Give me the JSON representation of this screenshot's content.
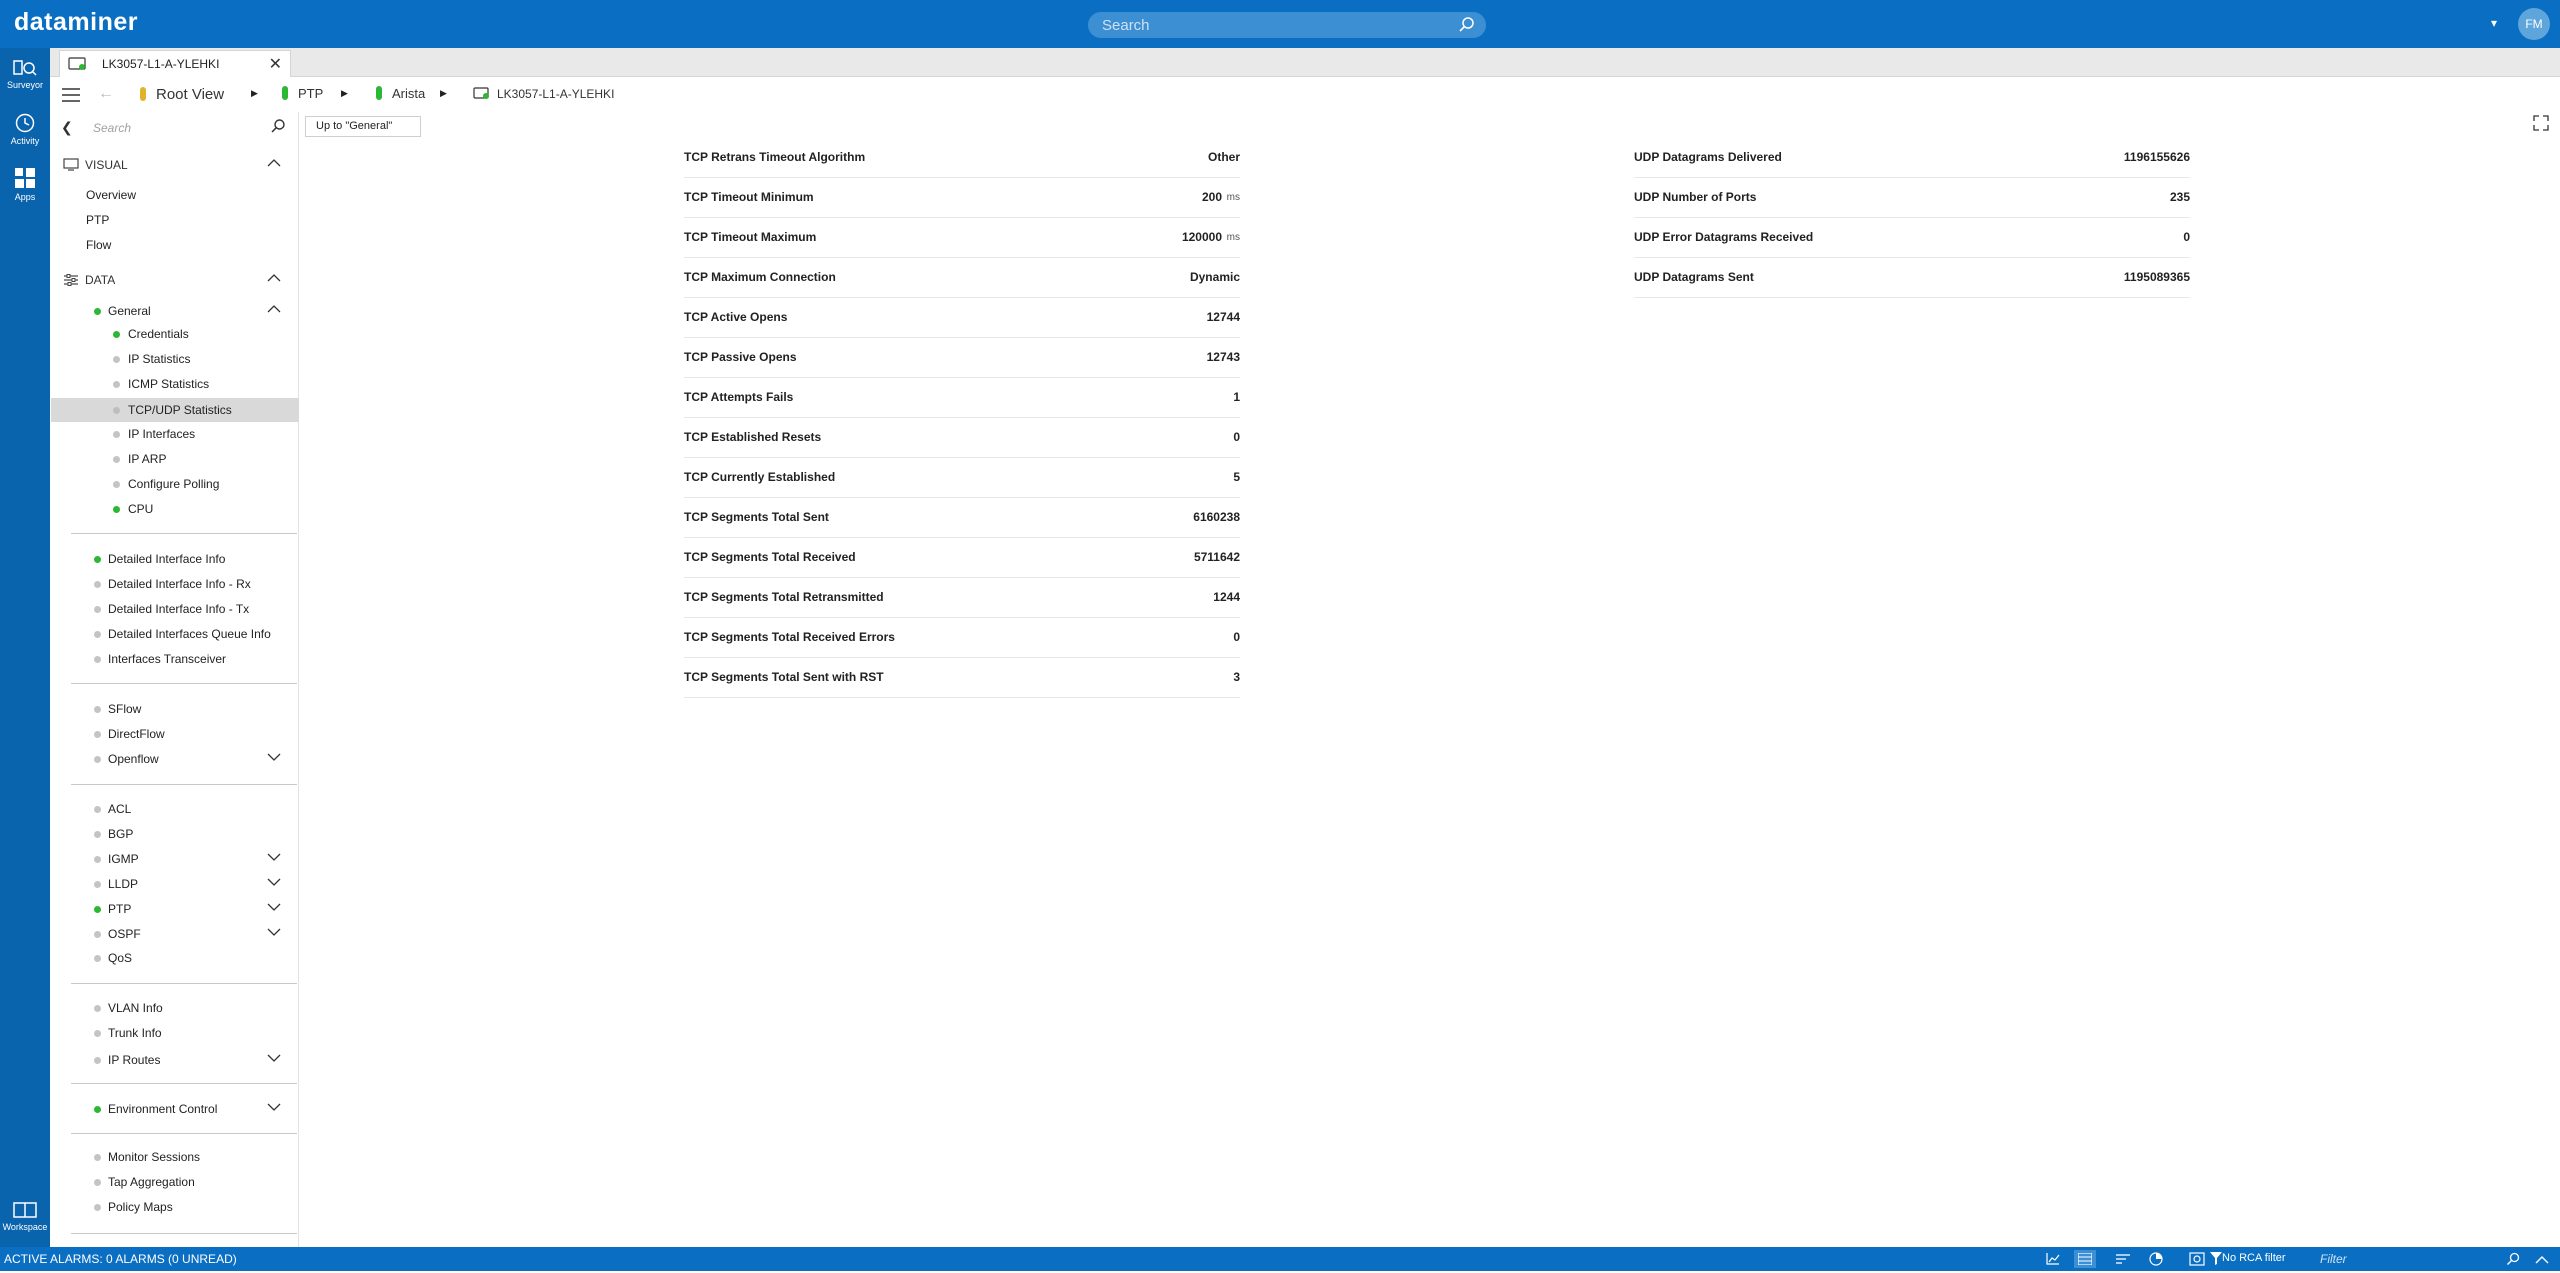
{
  "app": {
    "logo": "dataminer",
    "search_placeholder": "Search",
    "user_initials": "FM"
  },
  "rail": [
    {
      "label": "Surveyor",
      "icon": "surveyor-icon"
    },
    {
      "label": "Activity",
      "icon": "activity-icon"
    },
    {
      "label": "Apps",
      "icon": "apps-icon"
    },
    {
      "label": "Workspace",
      "icon": "workspace-icon"
    }
  ],
  "tab": {
    "label": "LK3057-L1-A-YLEHKI",
    "icon": "element-icon"
  },
  "breadcrumb": {
    "root": "Root View",
    "items": [
      "PTP",
      "Arista",
      "LK3057-L1-A-YLEHKI"
    ]
  },
  "nav": {
    "search_placeholder": "Search",
    "visual": {
      "title": "VISUAL",
      "items": [
        "Overview",
        "PTP",
        "Flow"
      ]
    },
    "data": {
      "title": "DATA"
    },
    "general": {
      "label": "General",
      "items": [
        "Credentials",
        "IP Statistics",
        "ICMP Statistics",
        "TCP/UDP Statistics",
        "IP Interfaces",
        "IP ARP",
        "Configure Polling",
        "CPU"
      ]
    },
    "group1": [
      "Detailed Interface Info",
      "Detailed Interface Info - Rx",
      "Detailed Interface Info - Tx",
      "Detailed Interfaces Queue Info",
      "Interfaces Transceiver"
    ],
    "group2": [
      "SFlow",
      "DirectFlow",
      "Openflow"
    ],
    "group3": [
      "ACL",
      "BGP",
      "IGMP",
      "LLDP",
      "PTP",
      "OSPF",
      "QoS"
    ],
    "group4": [
      "VLAN Info",
      "Trunk Info",
      "IP Routes"
    ],
    "group5": [
      "Environment Control"
    ],
    "group6": [
      "Monitor Sessions",
      "Tap Aggregation",
      "Policy Maps"
    ]
  },
  "up_button": "Up to \"General\"",
  "tcp": [
    {
      "name": "TCP Retrans Timeout Algorithm",
      "value": "Other",
      "unit": ""
    },
    {
      "name": "TCP Timeout Minimum",
      "value": "200",
      "unit": "ms"
    },
    {
      "name": "TCP Timeout Maximum",
      "value": "120000",
      "unit": "ms"
    },
    {
      "name": "TCP Maximum Connection",
      "value": "Dynamic",
      "unit": ""
    },
    {
      "name": "TCP Active Opens",
      "value": "12744",
      "unit": ""
    },
    {
      "name": "TCP Passive Opens",
      "value": "12743",
      "unit": ""
    },
    {
      "name": "TCP Attempts Fails",
      "value": "1",
      "unit": ""
    },
    {
      "name": "TCP Established Resets",
      "value": "0",
      "unit": ""
    },
    {
      "name": "TCP Currently Established",
      "value": "5",
      "unit": ""
    },
    {
      "name": "TCP Segments Total Sent",
      "value": "6160238",
      "unit": ""
    },
    {
      "name": "TCP Segments Total Received",
      "value": "5711642",
      "unit": ""
    },
    {
      "name": "TCP Segments Total Retransmitted",
      "value": "1244",
      "unit": ""
    },
    {
      "name": "TCP Segments Total Received Errors",
      "value": "0",
      "unit": ""
    },
    {
      "name": "TCP Segments Total Sent with RST",
      "value": "3",
      "unit": ""
    }
  ],
  "udp": [
    {
      "name": "UDP Datagrams Delivered",
      "value": "1196155626"
    },
    {
      "name": "UDP Number of Ports",
      "value": "235"
    },
    {
      "name": "UDP Error Datagrams Received",
      "value": "0"
    },
    {
      "name": "UDP Datagrams Sent",
      "value": "1195089365"
    }
  ],
  "status": {
    "alarms": "ACTIVE ALARMS: 0 ALARMS (0 UNREAD)",
    "rca": "No RCA filter",
    "filter_placeholder": "Filter"
  },
  "colors": {
    "brand": "#0a6fc2",
    "led_green": "#2cb734",
    "led_grey": "#c4c4c4",
    "selected": "#d9d9d9"
  }
}
